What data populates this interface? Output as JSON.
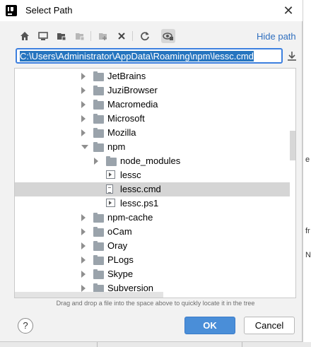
{
  "window": {
    "title": "Select Path"
  },
  "toolbar": {
    "icons": [
      "home-icon",
      "desktop-icon",
      "project-icon",
      "module-icon",
      "new-folder-icon",
      "delete-icon",
      "refresh-icon",
      "show-hidden-icon"
    ],
    "hide_path_label": "Hide path"
  },
  "path": {
    "value": "C:\\Users\\Administrator\\AppData\\Roaming\\npm\\lessc.cmd"
  },
  "tree": {
    "rows": [
      {
        "label": "JetBrains",
        "type": "folder",
        "expand": "collapsed",
        "depth": 0
      },
      {
        "label": "JuziBrowser",
        "type": "folder",
        "expand": "collapsed",
        "depth": 0
      },
      {
        "label": "Macromedia",
        "type": "folder",
        "expand": "collapsed",
        "depth": 0
      },
      {
        "label": "Microsoft",
        "type": "folder",
        "expand": "collapsed",
        "depth": 0
      },
      {
        "label": "Mozilla",
        "type": "folder",
        "expand": "collapsed",
        "depth": 0
      },
      {
        "label": "npm",
        "type": "folder",
        "expand": "expanded",
        "depth": 0
      },
      {
        "label": "node_modules",
        "type": "folder",
        "expand": "collapsed",
        "depth": 1
      },
      {
        "label": "lessc",
        "type": "cmd",
        "expand": "none",
        "depth": 1
      },
      {
        "label": "lessc.cmd",
        "type": "text",
        "expand": "none",
        "depth": 1,
        "selected": true
      },
      {
        "label": "lessc.ps1",
        "type": "cmd",
        "expand": "none",
        "depth": 1
      },
      {
        "label": "npm-cache",
        "type": "folder",
        "expand": "collapsed",
        "depth": 0
      },
      {
        "label": "oCam",
        "type": "folder",
        "expand": "collapsed",
        "depth": 0
      },
      {
        "label": "Oray",
        "type": "folder",
        "expand": "collapsed",
        "depth": 0
      },
      {
        "label": "PLogs",
        "type": "folder",
        "expand": "collapsed",
        "depth": 0
      },
      {
        "label": "Skype",
        "type": "folder",
        "expand": "collapsed",
        "depth": 0
      },
      {
        "label": "Subversion",
        "type": "folder",
        "expand": "collapsed",
        "depth": 0
      }
    ]
  },
  "hint": "Drag and drop a file into the space above to quickly locate it in the tree",
  "buttons": {
    "help": "?",
    "ok": "OK",
    "cancel": "Cancel"
  },
  "background_window": {
    "text_1": "e",
    "text_2": "fr",
    "text_3": "N"
  }
}
